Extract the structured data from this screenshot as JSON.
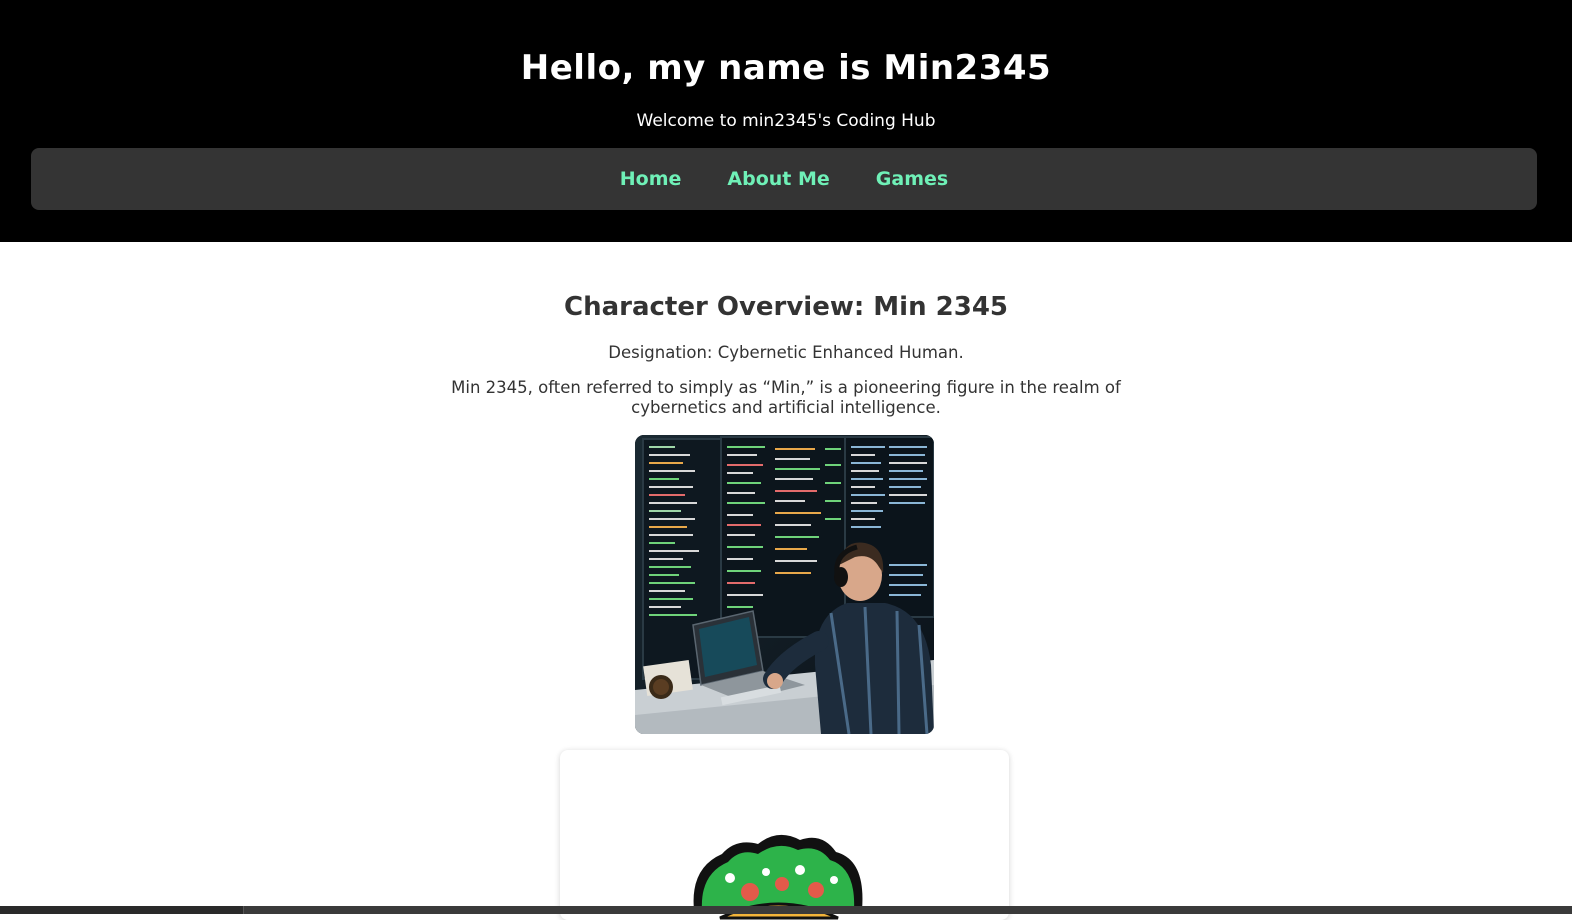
{
  "header": {
    "title": "Hello, my name is Min2345",
    "subtitle": "Welcome to min2345's Coding Hub"
  },
  "nav": {
    "items": [
      {
        "label": "Home"
      },
      {
        "label": "About Me"
      },
      {
        "label": "Games"
      }
    ],
    "link_color": "#6ff0b7"
  },
  "main": {
    "heading": "Character Overview: Min 2345",
    "designation": "Designation: Cybernetic Enhanced Human.",
    "bio": "Min 2345, often referred to simply as “Min,” is a pioneering figure in the realm of cybernetics and artificial intelligence.",
    "photo_icon": "person-coding-at-monitors-photo",
    "card_icon": "game-avatar-icon"
  },
  "colors": {
    "header_bg": "#000000",
    "nav_bg": "#343434",
    "text": "#333333"
  }
}
